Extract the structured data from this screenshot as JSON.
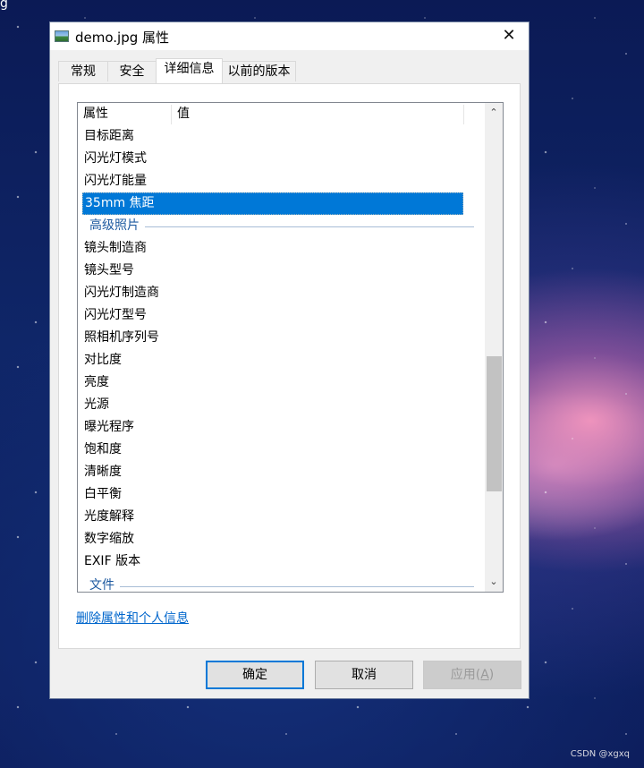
{
  "desktop": {
    "corner_glyph": "g",
    "watermark": "CSDN @xgxq"
  },
  "window": {
    "title": "demo.jpg 属性",
    "close_symbol": "✕"
  },
  "tabs": [
    {
      "label": "常规"
    },
    {
      "label": "安全"
    },
    {
      "label": "详细信息",
      "active": true
    },
    {
      "label": "以前的版本"
    }
  ],
  "list": {
    "columns": [
      "属性",
      "值"
    ],
    "items": [
      {
        "label": "目标距离"
      },
      {
        "label": "闪光灯模式"
      },
      {
        "label": "闪光灯能量"
      },
      {
        "label": "35mm 焦距",
        "selected": true
      },
      {
        "group": "高级照片"
      },
      {
        "label": "镜头制造商"
      },
      {
        "label": "镜头型号"
      },
      {
        "label": "闪光灯制造商"
      },
      {
        "label": "闪光灯型号"
      },
      {
        "label": "照相机序列号"
      },
      {
        "label": "对比度"
      },
      {
        "label": "亮度"
      },
      {
        "label": "光源"
      },
      {
        "label": "曝光程序"
      },
      {
        "label": "饱和度"
      },
      {
        "label": "清晰度"
      },
      {
        "label": "白平衡"
      },
      {
        "label": "光度解释"
      },
      {
        "label": "数字缩放"
      },
      {
        "label": "EXIF 版本"
      },
      {
        "group": "文件"
      }
    ],
    "scrollbar": {
      "up": "⌃",
      "down": "⌄",
      "thumb_start_fraction": 0.52,
      "thumb_size_fraction": 0.3
    }
  },
  "remove_link": "删除属性和个人信息",
  "buttons": {
    "ok": "确定",
    "cancel": "取消",
    "apply_prefix": "应用(",
    "apply_key": "A",
    "apply_suffix": ")"
  },
  "colors": {
    "selection": "#0078d7",
    "group_text": "#1e5aa0",
    "link": "#0066cc"
  }
}
